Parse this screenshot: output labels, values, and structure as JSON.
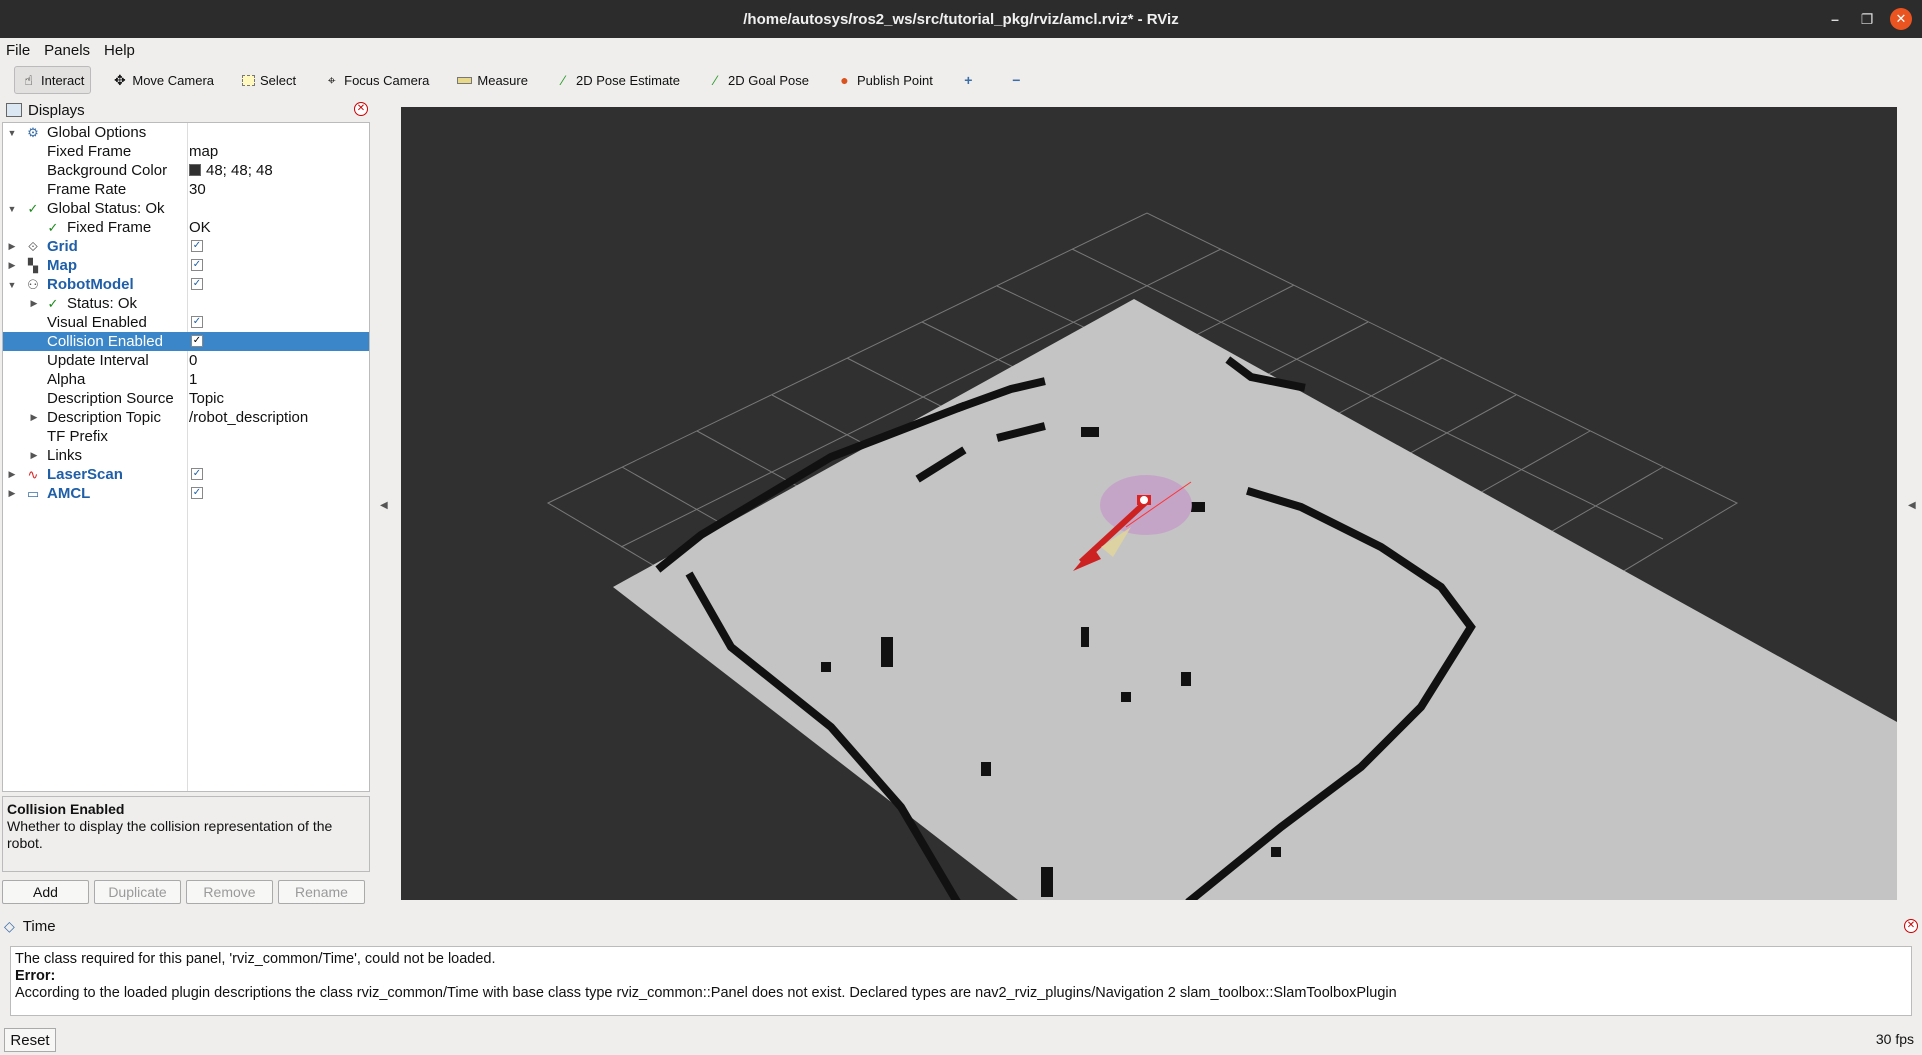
{
  "window": {
    "title": "/home/autosys/ros2_ws/src/tutorial_pkg/rviz/amcl.rviz* - RViz"
  },
  "menu": [
    "File",
    "Panels",
    "Help"
  ],
  "toolbar": {
    "interact": "Interact",
    "move_camera": "Move Camera",
    "select": "Select",
    "focus_camera": "Focus Camera",
    "measure": "Measure",
    "pose_estimate": "2D Pose Estimate",
    "goal_pose": "2D Goal Pose",
    "publish_point": "Publish Point"
  },
  "displays": {
    "title": "Displays",
    "global_options": "Global Options",
    "fixed_frame_label": "Fixed Frame",
    "fixed_frame_value": "map",
    "background_color_label": "Background Color",
    "background_color_value": "48; 48; 48",
    "background_color_hex": "#303030",
    "frame_rate_label": "Frame Rate",
    "frame_rate_value": "30",
    "global_status": "Global Status: Ok",
    "status_fixed_frame_label": "Fixed Frame",
    "status_fixed_frame_value": "OK",
    "grid": "Grid",
    "map": "Map",
    "robot_model": "RobotModel",
    "rm_status": "Status: Ok",
    "visual_enabled": "Visual Enabled",
    "collision_enabled": "Collision Enabled",
    "update_interval_label": "Update Interval",
    "update_interval_value": "0",
    "alpha_label": "Alpha",
    "alpha_value": "1",
    "description_source_label": "Description Source",
    "description_source_value": "Topic",
    "description_topic_label": "Description Topic",
    "description_topic_value": "/robot_description",
    "tf_prefix": "TF Prefix",
    "links": "Links",
    "laser_scan": "LaserScan",
    "amcl": "AMCL"
  },
  "description": {
    "title": "Collision Enabled",
    "text": "Whether to display the collision representation of the robot."
  },
  "buttons": {
    "add": "Add",
    "duplicate": "Duplicate",
    "remove": "Remove",
    "rename": "Rename"
  },
  "time_panel": {
    "title": "Time",
    "line1": "The class required for this panel, 'rviz_common/Time', could not be loaded.",
    "error_label": "Error:",
    "line2": "According to the loaded plugin descriptions the class rviz_common/Time with base class type rviz_common::Panel does not exist. Declared types are nav2_rviz_plugins/Navigation 2 slam_toolbox::SlamToolboxPlugin"
  },
  "reset": "Reset",
  "fps": "30 fps"
}
